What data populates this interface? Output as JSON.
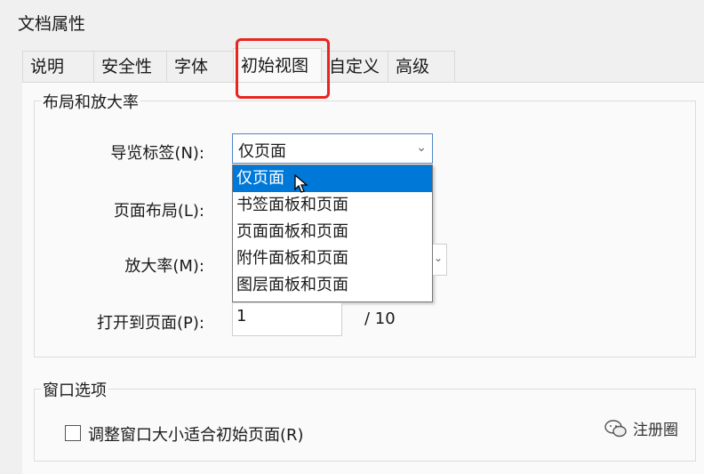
{
  "window": {
    "title": "文档属性"
  },
  "tabs": [
    {
      "label": "说明"
    },
    {
      "label": "安全性"
    },
    {
      "label": "字体"
    },
    {
      "label": "初始视图"
    },
    {
      "label": "自定义"
    },
    {
      "label": "高级"
    }
  ],
  "active_tab": "初始视图",
  "layout_group": {
    "title": "布局和放大率",
    "nav_label": "导览标签(N):",
    "nav_value": "仅页面",
    "nav_options": [
      "仅页面",
      "书签面板和页面",
      "页面面板和页面",
      "附件面板和页面",
      "图层面板和页面"
    ],
    "page_layout_label": "页面布局(L):",
    "zoom_label": "放大率(M):",
    "open_page_label": "打开到页面(P):",
    "open_page_value": "1",
    "total_pages": "/ 10"
  },
  "window_group": {
    "title": "窗口选项",
    "resize_checkbox_label": "调整窗口大小适合初始页面(R)",
    "resize_checked": false
  },
  "watermark": {
    "text": "注册圈"
  },
  "colors": {
    "highlight": "#e8251f",
    "selection": "#0078d7"
  }
}
